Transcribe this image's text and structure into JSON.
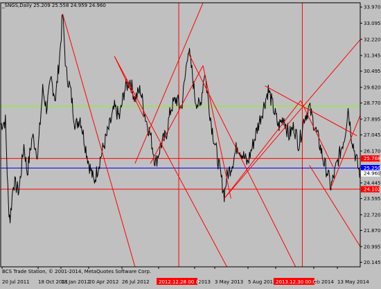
{
  "chart_data": {
    "type": "line",
    "title": "_SNGS,Daily  25.209 25.558 24.959 24.960",
    "footer": "BCS Trade Station, © 2001-2014, MetaQuotes Software Corp.",
    "colors": {
      "background": "#c0c0c0",
      "price": "#000000",
      "trendline": "#ff0000",
      "green_level": "#80ff00",
      "blue_level": "#0000ff",
      "label_bg": "#ff0000",
      "label_text": "#ffffff"
    },
    "ylim": [
      19.9,
      34.2
    ],
    "y_ticks": [
      "33.970",
      "33.095",
      "32.220",
      "31.345",
      "30.495",
      "29.620",
      "28.770",
      "27.895",
      "27.045",
      "26.170",
      "25.295",
      "24.445",
      "23.595",
      "22.720",
      "21.870",
      "20.995",
      "20.145"
    ],
    "x_ticks": [
      "20 Jul 2011",
      "18 Oct 2011",
      "18 Jan 2012",
      "20 Apr 2012",
      "26 Jul 2012",
      "2012.12.28 00:00",
      "r 2013",
      "3 May 2013",
      "5 Aug 2013",
      "2013.12.30 00:00",
      "eb 2014",
      "13 May 2014"
    ],
    "x_range": [
      "2011-07-18",
      "2014-06-20"
    ],
    "levels": [
      {
        "value": 28.6,
        "color": "#80ff00",
        "label": ""
      },
      {
        "value": 25.768,
        "color": "#ff0000",
        "label": "25.768"
      },
      {
        "value": 25.25,
        "color": "#0000ff",
        "label": "25.250"
      },
      {
        "value": 24.102,
        "color": "#ff0000",
        "label": "24.102"
      }
    ],
    "current_price": "24.960",
    "vertical_markers": [
      "2012-12-28",
      "2013-12-30"
    ],
    "series": [
      {
        "values": [
          [
            "2011-07-18",
            27.6
          ],
          [
            "2011-08-01",
            27.8
          ],
          [
            "2011-08-10",
            23.2
          ],
          [
            "2011-08-15",
            22.5
          ],
          [
            "2011-08-25",
            24.5
          ],
          [
            "2011-09-10",
            24.0
          ],
          [
            "2011-09-25",
            26.5
          ],
          [
            "2011-10-05",
            25.0
          ],
          [
            "2011-10-20",
            27.0
          ],
          [
            "2011-11-05",
            26.0
          ],
          [
            "2011-11-20",
            29.5
          ],
          [
            "2011-12-01",
            28.5
          ],
          [
            "2011-12-15",
            30.0
          ],
          [
            "2011-12-28",
            29.0
          ],
          [
            "2012-01-10",
            31.5
          ],
          [
            "2012-01-18",
            33.6
          ],
          [
            "2012-01-28",
            30.5
          ],
          [
            "2012-02-10",
            29.5
          ],
          [
            "2012-02-25",
            27.5
          ],
          [
            "2012-03-10",
            28.0
          ],
          [
            "2012-03-25",
            26.5
          ],
          [
            "2012-04-05",
            25.5
          ],
          [
            "2012-04-20",
            24.5
          ],
          [
            "2012-05-05",
            25.5
          ],
          [
            "2012-05-20",
            26.5
          ],
          [
            "2012-06-05",
            27.5
          ],
          [
            "2012-06-20",
            28.5
          ],
          [
            "2012-07-05",
            28.0
          ],
          [
            "2012-07-20",
            29.5
          ],
          [
            "2012-08-05",
            30.0
          ],
          [
            "2012-08-20",
            29.0
          ],
          [
            "2012-09-05",
            29.5
          ],
          [
            "2012-09-20",
            28.0
          ],
          [
            "2012-10-05",
            27.0
          ],
          [
            "2012-10-20",
            25.5
          ],
          [
            "2012-11-05",
            26.5
          ],
          [
            "2012-11-20",
            27.0
          ],
          [
            "2012-12-05",
            28.5
          ],
          [
            "2012-12-20",
            29.0
          ],
          [
            "2013-01-05",
            28.5
          ],
          [
            "2013-01-15",
            30.0
          ],
          [
            "2013-01-25",
            31.8
          ],
          [
            "2013-02-05",
            30.5
          ],
          [
            "2013-02-15",
            29.0
          ],
          [
            "2013-03-01",
            28.5
          ],
          [
            "2013-03-15",
            30.5
          ],
          [
            "2013-03-25",
            29.0
          ],
          [
            "2013-04-05",
            27.5
          ],
          [
            "2013-04-20",
            26.0
          ],
          [
            "2013-05-05",
            24.5
          ],
          [
            "2013-05-12",
            23.8
          ],
          [
            "2013-05-20",
            24.8
          ],
          [
            "2013-06-05",
            25.5
          ],
          [
            "2013-06-20",
            26.5
          ],
          [
            "2013-07-05",
            26.0
          ],
          [
            "2013-07-20",
            25.5
          ],
          [
            "2013-08-05",
            26.5
          ],
          [
            "2013-08-20",
            27.5
          ],
          [
            "2013-09-05",
            28.5
          ],
          [
            "2013-09-20",
            29.5
          ],
          [
            "2013-10-05",
            28.5
          ],
          [
            "2013-10-20",
            27.5
          ],
          [
            "2013-11-05",
            28.0
          ],
          [
            "2013-11-20",
            27.0
          ],
          [
            "2013-12-05",
            27.5
          ],
          [
            "2013-12-20",
            26.5
          ],
          [
            "2014-01-05",
            28.0
          ],
          [
            "2014-01-20",
            28.5
          ],
          [
            "2014-02-05",
            27.5
          ],
          [
            "2014-02-20",
            26.5
          ],
          [
            "2014-03-05",
            25.5
          ],
          [
            "2014-03-15",
            25.0
          ],
          [
            "2014-03-25",
            24.2
          ],
          [
            "2014-04-05",
            25.0
          ],
          [
            "2014-04-20",
            26.0
          ],
          [
            "2014-05-05",
            27.0
          ],
          [
            "2014-05-15",
            28.5
          ],
          [
            "2014-05-25",
            27.0
          ],
          [
            "2014-06-05",
            26.0
          ],
          [
            "2014-06-15",
            25.2
          ],
          [
            "2014-06-20",
            24.96
          ]
        ]
      }
    ],
    "trendlines": [
      [
        [
          "2012-01-18",
          33.6
        ],
        [
          "2012-08-20",
          19.9
        ]
      ],
      [
        [
          "2012-06-20",
          31.3
        ],
        [
          "2013-05-20",
          19.9
        ]
      ],
      [
        [
          "2012-06-20",
          31.3
        ],
        [
          "2012-09-15",
          28.0
        ]
      ],
      [
        [
          "2012-08-20",
          25.5
        ],
        [
          "2013-03-10",
          34.2
        ]
      ],
      [
        [
          "2012-10-05",
          25.5
        ],
        [
          "2013-03-10",
          30.8
        ]
      ],
      [
        [
          "2013-03-10",
          30.8
        ],
        [
          "2013-06-01",
          23.6
        ]
      ],
      [
        [
          "2013-01-25",
          31.5
        ],
        [
          "2013-12-10",
          19.9
        ]
      ],
      [
        [
          "2013-05-12",
          23.6
        ],
        [
          "2014-06-20",
          32.2
        ]
      ],
      [
        [
          "2013-05-12",
          23.6
        ],
        [
          "2013-12-25",
          28.9
        ]
      ],
      [
        [
          "2013-09-10",
          29.7
        ],
        [
          "2014-06-10",
          27.0
        ]
      ],
      [
        [
          "2013-12-25",
          28.9
        ],
        [
          "2014-04-01",
          25.3
        ]
      ],
      [
        [
          "2014-03-25",
          24.2
        ],
        [
          "2014-06-20",
          28.1
        ]
      ],
      [
        [
          "2014-01-20",
          25.4
        ],
        [
          "2014-06-20",
          21.0
        ]
      ]
    ]
  }
}
